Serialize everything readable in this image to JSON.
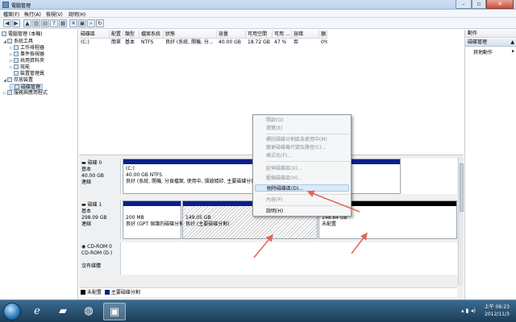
{
  "window": {
    "title": "電腦管理",
    "min": "–",
    "max": "▫",
    "close": "✕"
  },
  "menu": [
    "檔案(F)",
    "執行(A)",
    "檢視(V)",
    "說明(H)"
  ],
  "toolbar": [
    "back-icon",
    "forward-icon",
    "up-icon",
    "show-hide-tree-icon",
    "properties-icon",
    "help-icon",
    "properties2-icon",
    "delete-icon",
    "disk-icon",
    "rescan-icon",
    "refresh-icon"
  ],
  "tree": {
    "root": "電腦管理 (本機)",
    "items": [
      {
        "label": "系統工具",
        "indent": 1,
        "exp": "◢"
      },
      {
        "label": "工作排程器",
        "indent": 2,
        "exp": "▷"
      },
      {
        "label": "事件檢視器",
        "indent": 2,
        "exp": "▷"
      },
      {
        "label": "共用資料夾",
        "indent": 2,
        "exp": "▷"
      },
      {
        "label": "效能",
        "indent": 2,
        "exp": "▷"
      },
      {
        "label": "裝置管理員",
        "indent": 2,
        "exp": ""
      },
      {
        "label": "存放裝置",
        "indent": 1,
        "exp": "◢"
      },
      {
        "label": "磁碟管理",
        "indent": 2,
        "exp": "",
        "selected": true
      },
      {
        "label": "服務與應用程式",
        "indent": 1,
        "exp": "▷"
      }
    ]
  },
  "volume_table": {
    "headers": [
      "磁碟區",
      "配置",
      "類型",
      "檔案系統",
      "狀態",
      "容量",
      "可用空間",
      "可用 ...",
      "容錯",
      "額..."
    ],
    "rows": [
      [
        "(C:)",
        "簡單",
        "基本",
        "NTFS",
        "良好 (系統, 開機, 分...",
        "40.00 GB",
        "18.72 GB",
        "47 %",
        "否",
        "0%"
      ]
    ]
  },
  "disks": [
    {
      "name": "磁碟 0",
      "type": "基本",
      "size": "40.00 GB",
      "status": "連線",
      "parts": [
        {
          "l1": "(C:)",
          "l2": "40.00 GB NTFS",
          "l3": "良好 (系統, 開機, 分頁檔案, 使用中, 損毀傾印, 主要磁碟分割)"
        }
      ]
    },
    {
      "name": "磁碟 1",
      "type": "基本",
      "size": "298.09 GB",
      "status": "連線",
      "parts": [
        {
          "l1": "",
          "l2": "200 MB",
          "l3": "良好 (GPT 保護的磁碟分割)"
        },
        {
          "l1": "",
          "l2": "149.05 GB",
          "l3": "良好 (主要磁碟分割)"
        },
        {
          "l1": "",
          "l2": "148.84 GB",
          "l3": "未配置"
        }
      ]
    },
    {
      "name": "CD-ROM 0",
      "type": "CD-ROM (D:)",
      "size": "",
      "status": "沒有媒體"
    }
  ],
  "legend": [
    {
      "label": "未配置",
      "color": "#000000"
    },
    {
      "label": "主要磁碟分割",
      "color": "#0a1f8a"
    }
  ],
  "actions": {
    "header": "動作",
    "section": "磁碟管理",
    "more": "其他動作"
  },
  "context_menu": [
    {
      "label": "開啟(O)",
      "enabled": false
    },
    {
      "label": "瀏覽(E)",
      "enabled": false
    },
    {
      "sep": true
    },
    {
      "label": "標記磁碟分割區為使用中(M)",
      "enabled": false
    },
    {
      "label": "變更磁碟機代號及路徑(C)...",
      "enabled": false
    },
    {
      "label": "格式化(F)...",
      "enabled": false
    },
    {
      "sep": true
    },
    {
      "label": "延伸磁碟區(X)...",
      "enabled": false
    },
    {
      "label": "壓縮磁碟區(H)...",
      "enabled": false
    },
    {
      "label": "刪除磁碟區(D)...",
      "enabled": true,
      "highlight": true
    },
    {
      "sep": true
    },
    {
      "label": "內容(P)",
      "enabled": false
    },
    {
      "sep": true
    },
    {
      "label": "說明(H)",
      "enabled": true
    }
  ],
  "taskbar": {
    "apps": [
      "ie-icon",
      "explorer-icon",
      "firefox-icon",
      "computer-management-icon"
    ],
    "time": "上午 06:23",
    "date": "2012/11/3"
  },
  "colors": {
    "primary_partition": "#0a1f8a",
    "unallocated": "#000000",
    "annotation_arrow": "#e0665a"
  }
}
